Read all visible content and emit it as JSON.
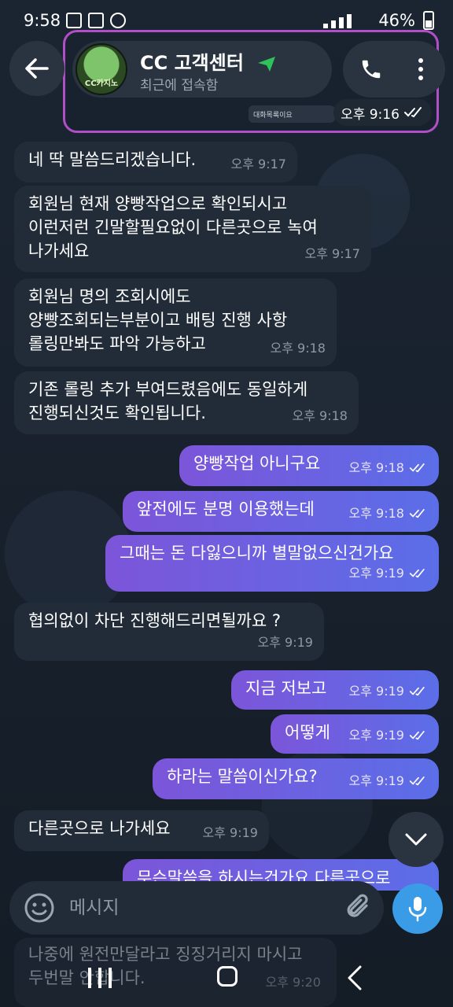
{
  "statusbar": {
    "time": "9:58",
    "battery": "46%"
  },
  "header": {
    "title": "CC 고객센터",
    "status": "최근에 접속함",
    "avatar_text": "CC카지노",
    "pinned_preview": "대화목록이요",
    "pinned_time": "오후 9:16"
  },
  "messages": [
    {
      "dir": "in",
      "text": "네 딱 말씀드리겠습니다.",
      "time": "오후 9:17"
    },
    {
      "dir": "in",
      "text": "회원님 현재 양빵작업으로 확인되시고\n이런저런 긴말할필요없이 다른곳으로 녹여\n나가세요",
      "time": "오후 9:17"
    },
    {
      "dir": "in",
      "text": "회원님 명의 조회시에도\n양빵조회되는부분이고 배팅 진행 사항\n롤링만봐도 파악 가능하고",
      "time": "오후 9:18"
    },
    {
      "dir": "in",
      "text": "기존 롤링 추가 부여드렸음에도 동일하게\n진행되신것도 확인됩니다.",
      "time": "오후 9:18"
    },
    {
      "dir": "out",
      "text": "양빵작업 아니구요",
      "time": "오후 9:18"
    },
    {
      "dir": "out",
      "text": "앞전에도 분명 이용했는데",
      "time": "오후 9:18"
    },
    {
      "dir": "out",
      "text": "그때는 돈 다잃으니까 별말없으신건가요",
      "time": "오후 9:19"
    },
    {
      "dir": "in",
      "text": "협의없이 차단 진행해드리면될까요 ?",
      "time": "오후 9:19"
    },
    {
      "dir": "out",
      "text": "지금 저보고",
      "time": "오후 9:19"
    },
    {
      "dir": "out",
      "text": "어떻게",
      "time": "오후 9:19"
    },
    {
      "dir": "out",
      "text": "하라는 말씀이신가요?",
      "time": "오후 9:19"
    },
    {
      "dir": "in",
      "text": "다른곳으로 나가세요",
      "time": "오후 9:19"
    }
  ],
  "partial_out": "무슨말씀을 하시는건가요 다른곳으로",
  "partial_in": {
    "text": "나중에 원전만달라고 징징거리지 마시고\n두번말 안합니다.",
    "time": "오후 9:20"
  },
  "composer": {
    "placeholder": "메시지"
  },
  "colors": {
    "accent": "#3a9ce6",
    "outgoing": "#6a62e0",
    "incoming": "#222c38",
    "pinned_border": "#b04fc8"
  }
}
